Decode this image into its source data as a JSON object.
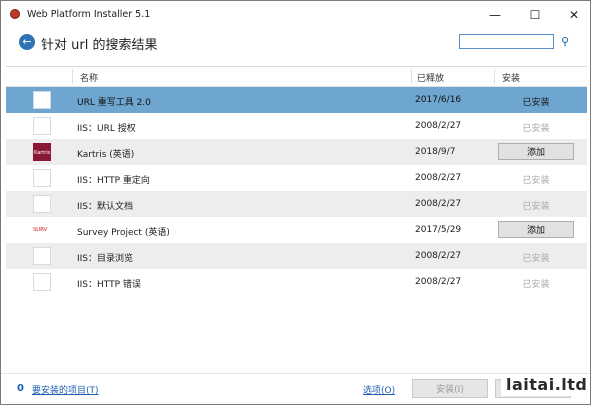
{
  "window": {
    "title": "Web Platform Installer 5.1"
  },
  "header": {
    "title": "针对 url 的搜索结果",
    "search_value": ""
  },
  "columns": {
    "name": "名称",
    "released": "已释放",
    "install": "安装"
  },
  "rows": [
    {
      "name": "URL 重写工具 2.0",
      "date": "2017/6/16",
      "status": "已安装",
      "action": "",
      "icon": "blank-thumb-icon",
      "selected": true
    },
    {
      "name": "IIS：URL 授权",
      "date": "2008/2/27",
      "status": "已安装",
      "action": "",
      "icon": "blank-thumb-icon"
    },
    {
      "name": "Kartris (英语)",
      "date": "2018/9/7",
      "status": "",
      "action": "添加",
      "icon": "kartris-logo",
      "logo_text": "Kartris"
    },
    {
      "name": "IIS：HTTP 重定向",
      "date": "2008/2/27",
      "status": "已安装",
      "action": "",
      "icon": "blank-thumb-icon"
    },
    {
      "name": "IIS：默认文档",
      "date": "2008/2/27",
      "status": "已安装",
      "action": "",
      "icon": "blank-thumb-icon"
    },
    {
      "name": "Survey Project (英语)",
      "date": "2017/5/29",
      "status": "",
      "action": "添加",
      "icon": "survey-project-logo",
      "logo_text": "SURV"
    },
    {
      "name": "IIS：目录浏览",
      "date": "2008/2/27",
      "status": "已安装",
      "action": "",
      "icon": "blank-thumb-icon"
    },
    {
      "name": "IIS：HTTP 错误",
      "date": "2008/2/27",
      "status": "已安装",
      "action": "",
      "icon": "blank-thumb-icon"
    }
  ],
  "footer": {
    "count": "0",
    "items_link": "要安装的项目(T)",
    "options_link": "选项(O)",
    "install_label": "安装(I)",
    "exit_label": "退出"
  },
  "watermark": "laitai.ltd",
  "colors": {
    "selected_row": "#6ea6cf",
    "alt_row": "#ededed",
    "link": "#1f5fb0",
    "accent": "#2e74b5"
  }
}
